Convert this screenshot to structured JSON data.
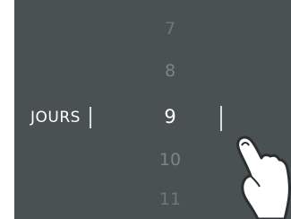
{
  "unit_label": "JOURS",
  "wheel": {
    "items": [
      "7",
      "8",
      "9",
      "10",
      "11"
    ],
    "selected": "9"
  },
  "partial_text": "0",
  "colors": {
    "screen_bg": "#4a5153",
    "selected_text": "#ffffff",
    "dim_text": "#7c8488"
  },
  "icons": {
    "pointer": "hand-pointer-icon"
  }
}
